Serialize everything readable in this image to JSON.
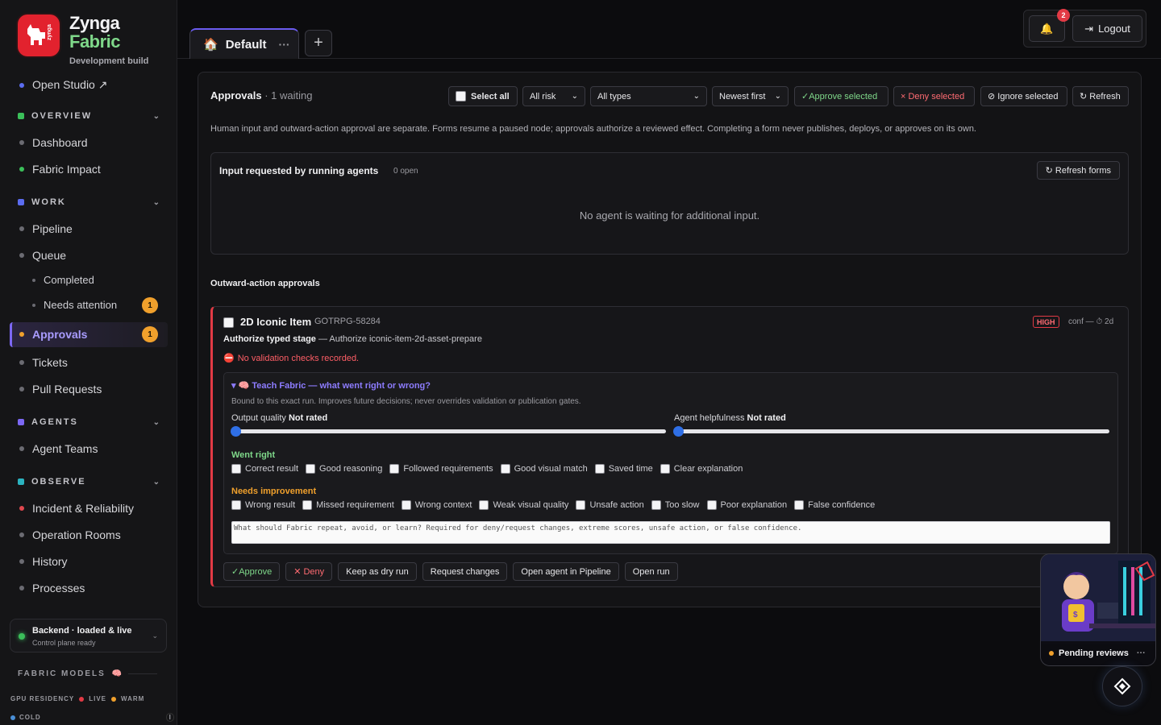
{
  "brand": {
    "name_line1": "Zynga",
    "name_line2": "Fabric",
    "subtitle": "Development build",
    "logo_text": "zynga"
  },
  "sidebar": {
    "open_studio": "Open Studio ↗",
    "sections": {
      "overview": "OVERVIEW",
      "work": "WORK",
      "agents": "AGENTS",
      "observe": "OBSERVE"
    },
    "items": {
      "dashboard": "Dashboard",
      "fabric_impact": "Fabric Impact",
      "pipeline": "Pipeline",
      "queue": "Queue",
      "completed": "Completed",
      "needs_attention": "Needs attention",
      "needs_attention_count": "1",
      "approvals": "Approvals",
      "approvals_count": "1",
      "tickets": "Tickets",
      "pull_requests": "Pull Requests",
      "agent_teams": "Agent Teams",
      "incident": "Incident & Reliability",
      "operation_rooms": "Operation Rooms",
      "history": "History",
      "processes": "Processes"
    },
    "backend": {
      "title": "Backend · loaded & live",
      "subtitle": "Control plane ready"
    },
    "fabric_models": "FABRIC MODELS",
    "gpu_residency": "GPU RESIDENCY",
    "live": "LIVE",
    "warm": "WARM",
    "cold": "COLD",
    "cold_count": "I"
  },
  "topbar": {
    "tab_label": "Default",
    "tab_more": "···",
    "add_tab": "+",
    "notifications_count": "2",
    "logout": "Logout"
  },
  "approvals": {
    "title": "Approvals",
    "waiting": " · 1 waiting",
    "select_all": "Select all",
    "risk_filter": "All risk",
    "type_filter": "All types",
    "sort": "Newest first",
    "approve_selected": "✓Approve selected",
    "deny_selected": "× Deny selected",
    "ignore_selected": "⊘ Ignore selected",
    "refresh": "↻ Refresh",
    "note": "Human input and outward-action approval are separate. Forms resume a paused node; approvals authorize a reviewed effect. Completing a form never publishes, deploys, or approves on its own."
  },
  "forms": {
    "title": "Input requested by running agents",
    "open_count": "0 open",
    "refresh": "↻ Refresh forms",
    "empty": "No agent is waiting for additional input."
  },
  "outward": {
    "title": "Outward-action approvals"
  },
  "card": {
    "title": "2D Iconic Item",
    "id": "GOTRPG-58284",
    "risk": "HIGH",
    "conf": "conf —",
    "age": "⏱ 2d",
    "stage_bold": "Authorize typed stage",
    "stage_rest": " — Authorize iconic-item-2d-asset-prepare",
    "validation": "No validation checks recorded.",
    "teach": {
      "title": "▾ 🧠 Teach Fabric — what went right or wrong?",
      "desc": "Bound to this exact run. Improves future decisions; never overrides validation or publication gates.",
      "output_quality": "Output quality",
      "output_value": "Not rated",
      "helpfulness": "Agent helpfulness",
      "helpfulness_value": "Not rated",
      "went_right": "Went right",
      "right_opts": [
        "Correct result",
        "Good reasoning",
        "Followed requirements",
        "Good visual match",
        "Saved time",
        "Clear explanation"
      ],
      "needs_improvement": "Needs improvement",
      "improve_opts": [
        "Wrong result",
        "Missed requirement",
        "Wrong context",
        "Weak visual quality",
        "Unsafe action",
        "Too slow",
        "Poor explanation",
        "False confidence"
      ],
      "placeholder": "What should Fabric repeat, avoid, or learn? Required for deny/request changes, extreme scores, unsafe action, or false confidence."
    },
    "actions": {
      "approve": "✓Approve",
      "deny": "✕ Deny",
      "dry_run": "Keep as dry run",
      "request_changes": "Request changes",
      "open_pipeline": "Open agent in Pipeline",
      "open_run": "Open run"
    }
  },
  "floating": {
    "pending_reviews": "Pending reviews",
    "dots": "···"
  },
  "colors": {
    "accent": "#6b5cf0",
    "danger": "#e23a45",
    "success": "#3bbf5a",
    "warning": "#f0a02c"
  }
}
